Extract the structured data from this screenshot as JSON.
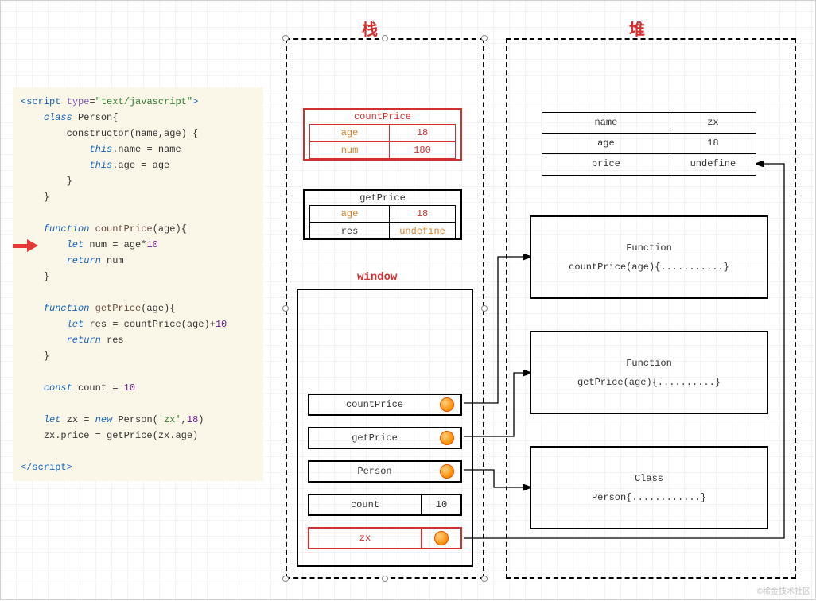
{
  "headers": {
    "stack": "栈",
    "heap": "堆"
  },
  "code": {
    "l1a": "<",
    "l1b": "script",
    "l1c": " type",
    "l1d": "=",
    "l1e": "\"text/javascript\"",
    "l1f": ">",
    "l2a": "class",
    "l2b": " Person{",
    "l3": "constructor(name,age) {",
    "l4a": "this",
    "l4b": ".name = name",
    "l5a": "this",
    "l5b": ".age = age",
    "l6": "}",
    "l7": "}",
    "l8a": "function",
    "l8b": " countPrice",
    "l8c": "(age){",
    "l9a": "let",
    "l9b": " num = age*",
    "l9c": "10",
    "l10a": "return",
    "l10b": " num",
    "l11": "}",
    "l12a": "function",
    "l12b": " getPrice",
    "l12c": "(age){",
    "l13a": "let",
    "l13b": " res = countPrice(age)+",
    "l13c": "10",
    "l14a": "return",
    "l14b": " res",
    "l15": "}",
    "l16a": "const",
    "l16b": " count = ",
    "l16c": "10",
    "l17a": "let",
    "l17b": " zx = ",
    "l17c": "new",
    "l17d": " Person(",
    "l17e": "'zx'",
    "l17f": ",",
    "l17g": "18",
    "l17h": ")",
    "l18": "zx.price = getPrice(zx.age)",
    "l19a": "</",
    "l19b": "script",
    "l19c": ">"
  },
  "stack": {
    "countPrice": {
      "title": "countPrice",
      "rows": [
        {
          "k": "age",
          "v": "18"
        },
        {
          "k": "num",
          "v": "180"
        }
      ]
    },
    "getPrice": {
      "title": "getPrice",
      "rows": [
        {
          "k": "age",
          "v": "18"
        },
        {
          "k": "res",
          "v": "undefine"
        }
      ]
    },
    "windowLabel": "window",
    "window": {
      "countPrice": "countPrice",
      "getPrice": "getPrice",
      "Person": "Person",
      "count": {
        "k": "count",
        "v": "10"
      },
      "zx": "zx"
    }
  },
  "heap": {
    "obj": [
      {
        "k": "name",
        "v": "zx"
      },
      {
        "k": "age",
        "v": "18"
      },
      {
        "k": "price",
        "v": "undefine"
      }
    ],
    "boxes": [
      {
        "title": "Function",
        "body": "countPrice(age){...........}"
      },
      {
        "title": "Function",
        "body": "getPrice(age){..........}"
      },
      {
        "title": "Class",
        "body": "Person{............}"
      }
    ]
  },
  "watermark": "©稀金技术社区"
}
